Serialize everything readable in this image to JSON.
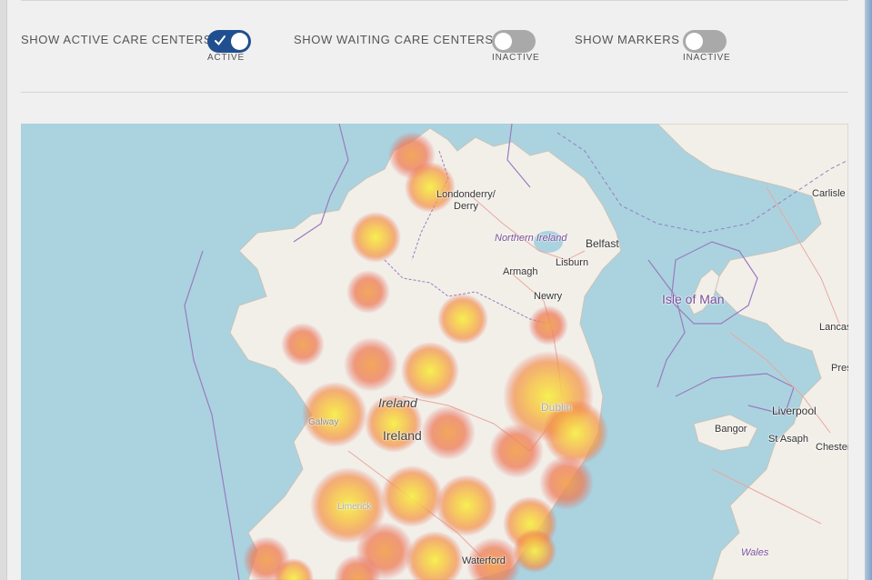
{
  "filters": {
    "active": {
      "label": "SHOW ACTIVE CARE CENTERS",
      "state": "ACTIVE",
      "on": true
    },
    "waiting": {
      "label": "SHOW WAITING CARE CENTERS",
      "state": "INACTIVE",
      "on": false
    },
    "markers": {
      "label": "SHOW MARKERS",
      "state": "INACTIVE",
      "on": false
    }
  },
  "map": {
    "labels": {
      "londonderry_1": "Londonderry/",
      "londonderry_2": "Derry",
      "northern_ireland": "Northern Ireland",
      "belfast": "Belfast",
      "lisburn": "Lisburn",
      "armagh": "Armagh",
      "newry": "Newry",
      "isle_of_man": "Isle of Man",
      "carlisle": "Carlisle",
      "lancaster": "Lancas",
      "preston": "Pres",
      "liverpool": "Liverpool",
      "bangor": "Bangor",
      "st_asaph": "St Asaph",
      "chester": "Chester",
      "wales": "Wales",
      "ireland_italic": "Ireland",
      "ireland": "Ireland",
      "galway": "Galway",
      "dublin": "Dublin",
      "limerick": "Limerick",
      "waterford": "Waterford"
    },
    "colors": {
      "sea": "#aad3df",
      "land": "#f2efe9",
      "border": "#9a7bbf",
      "heat_low": "#e8665a",
      "heat_mid": "#f5a24a",
      "heat_high": "#f6f04a"
    }
  }
}
